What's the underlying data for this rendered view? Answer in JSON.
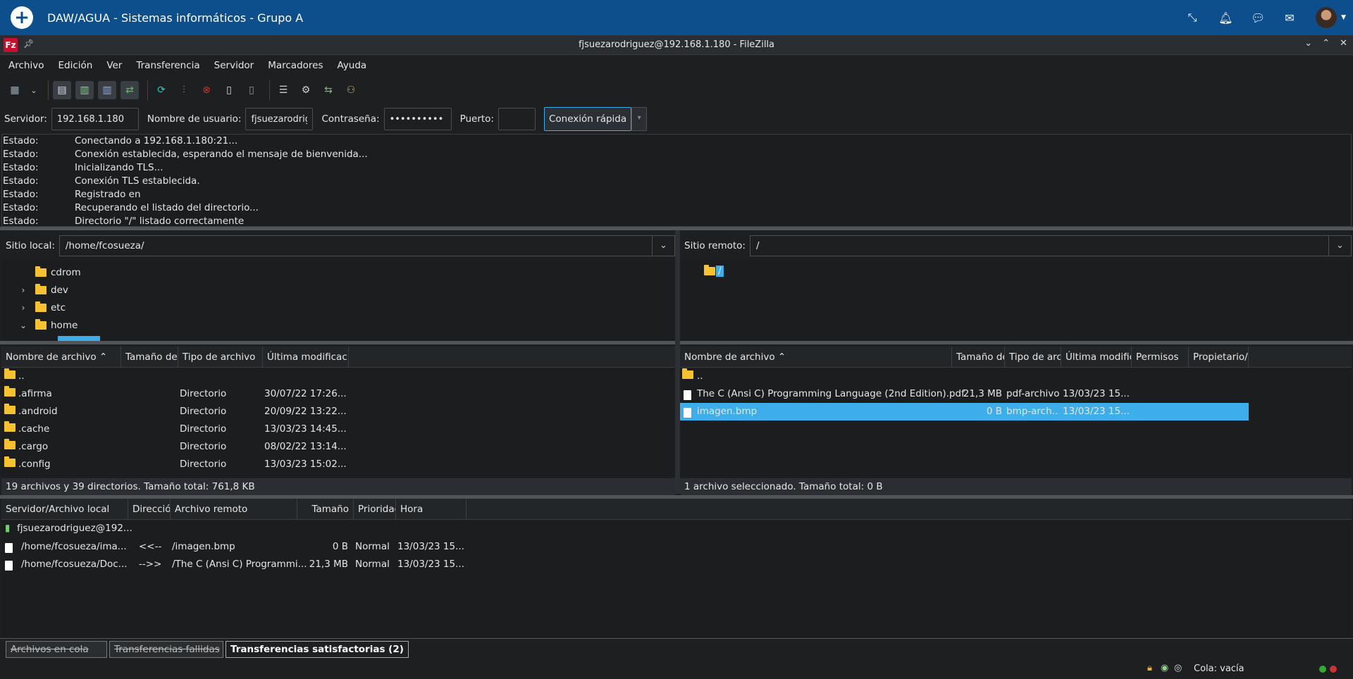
{
  "appbar": {
    "title": "DAW/AGUA - Sistemas informáticos - Grupo A",
    "icons": [
      "add-icon",
      "compress-icon",
      "bell-icon",
      "chat-icon",
      "mail-icon",
      "avatar"
    ]
  },
  "window": {
    "title": "fjsuezarodriguez@192.168.1.180 - FileZilla",
    "controls": [
      "minimize",
      "maximize",
      "close"
    ]
  },
  "menu": [
    "Archivo",
    "Edición",
    "Ver",
    "Transferencia",
    "Servidor",
    "Marcadores",
    "Ayuda"
  ],
  "quickconnect": {
    "server_label": "Servidor:",
    "server_value": "192.168.1.180",
    "user_label": "Nombre de usuario:",
    "user_value": "fjsuezarodrig",
    "pass_label": "Contraseña:",
    "pass_value": "••••••••••",
    "port_label": "Puerto:",
    "port_value": "",
    "button": "Conexión rápida"
  },
  "log": [
    {
      "k": "Estado:",
      "v": "Conectando a 192.168.1.180:21..."
    },
    {
      "k": "Estado:",
      "v": "Conexión establecida, esperando el mensaje de bienvenida..."
    },
    {
      "k": "Estado:",
      "v": "Inicializando TLS..."
    },
    {
      "k": "Estado:",
      "v": "Conexión TLS establecida."
    },
    {
      "k": "Estado:",
      "v": "Registrado en"
    },
    {
      "k": "Estado:",
      "v": "Recuperando el listado del directorio..."
    },
    {
      "k": "Estado:",
      "v": "Directorio \"/\" listado correctamente"
    }
  ],
  "local": {
    "label": "Sitio local:",
    "path": "/home/fcosueza/",
    "tree": [
      "cdrom",
      "dev",
      "etc",
      "home"
    ],
    "headers": [
      "Nombre de archivo",
      "Tamaño de a",
      "Tipo de archivo",
      "Última modificación"
    ],
    "rows": [
      {
        "name": "..",
        "size": "",
        "type": "",
        "date": ""
      },
      {
        "name": ".afirma",
        "size": "",
        "type": "Directorio",
        "date": "30/07/22 17:26..."
      },
      {
        "name": ".android",
        "size": "",
        "type": "Directorio",
        "date": "20/09/22 13:22..."
      },
      {
        "name": ".cache",
        "size": "",
        "type": "Directorio",
        "date": "13/03/23 14:45..."
      },
      {
        "name": ".cargo",
        "size": "",
        "type": "Directorio",
        "date": "08/02/22 13:14..."
      },
      {
        "name": ".config",
        "size": "",
        "type": "Directorio",
        "date": "13/03/23 15:02..."
      }
    ],
    "status": "19 archivos y 39 directorios. Tamaño total: 761,8 KB"
  },
  "remote": {
    "label": "Sitio remoto:",
    "path": "/",
    "tree": [
      "/"
    ],
    "headers": [
      "Nombre de archivo",
      "Tamaño de",
      "Tipo de arch",
      "Última modifica",
      "Permisos",
      "Propietario/G"
    ],
    "rows": [
      {
        "name": "..",
        "size": "",
        "type": "",
        "date": ""
      },
      {
        "name": "The C (Ansi C) Programming Language (2nd Edition).pdf",
        "size": "21,3 MB",
        "type": "pdf-archivo",
        "date": "13/03/23 15..."
      },
      {
        "name": "imagen.bmp",
        "size": "0 B",
        "type": "bmp-arch...",
        "date": "13/03/23 15..."
      }
    ],
    "status": "1 archivo seleccionado. Tamaño total: 0 B"
  },
  "queue": {
    "headers": [
      "Servidor/Archivo local",
      "Dirección",
      "Archivo remoto",
      "Tamaño",
      "Prioridad",
      "Hora"
    ],
    "server": "fjsuezarodriguez@192...",
    "rows": [
      {
        "local": "/home/fcosueza/ima...",
        "dir": "<<--",
        "remote": "/imagen.bmp",
        "size": "0 B",
        "prio": "Normal",
        "time": "13/03/23 15..."
      },
      {
        "local": "/home/fcosueza/Doc...",
        "dir": "-->>",
        "remote": "/The C (Ansi C) Programmi...",
        "size": "21,3 MB",
        "prio": "Normal",
        "time": "13/03/23 15..."
      }
    ]
  },
  "tabs": [
    "Archivos en cola",
    "Transferencias fallidas",
    "Transferencias satisfactorias (2)"
  ],
  "statusbar": {
    "queue": "Cola: vacía"
  },
  "colors": {
    "accent": "#3daee9",
    "appbar": "#0c4f8c",
    "folder": "#f6c230"
  }
}
